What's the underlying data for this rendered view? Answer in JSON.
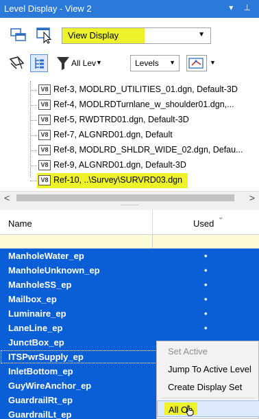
{
  "window": {
    "title": "Level Display - View 2",
    "controls": "▾ ⊥"
  },
  "toolbar": {
    "view_display_value": "View Display",
    "all_levels_label": "All Lev",
    "levels_label": "Levels"
  },
  "tree": {
    "badge": "V8",
    "items": [
      "Ref-3, MODLRD_UTILITIES_01.dgn, Default-3D",
      "Ref-4, MODLRDTurnlane_w_shoulder01.dgn,...",
      "Ref-5, RWDTRD01.dgn, Default-3D",
      "Ref-7, ALGNRD01.dgn, Default",
      "Ref-8, MODLRD_SHLDR_WIDE_02.dgn, Defau...",
      "Ref-9, ALGNRD01.dgn, Default-3D",
      "Ref-10, ..\\Survey\\SURVRD03.dgn"
    ]
  },
  "scroll": {
    "left": "<",
    "right": ">",
    "grip": "··········"
  },
  "columns": {
    "name": "Name",
    "used": "Used",
    "sort_icon": "⌄"
  },
  "levels": [
    {
      "name": "ManholeWater_ep",
      "used": "•"
    },
    {
      "name": "ManholeUnknown_ep",
      "used": "•"
    },
    {
      "name": "ManholeSS_ep",
      "used": "•"
    },
    {
      "name": "Mailbox_ep",
      "used": "•"
    },
    {
      "name": "Luminaire_ep",
      "used": "•"
    },
    {
      "name": "LaneLine_ep",
      "used": "•"
    },
    {
      "name": "JunctBox_ep",
      "used": "•"
    },
    {
      "name": "ITSPwrSupply_ep",
      "used": ""
    },
    {
      "name": "InletBottom_ep",
      "used": ""
    },
    {
      "name": "GuyWireAnchor_ep",
      "used": ""
    },
    {
      "name": "GuardrailRt_ep",
      "used": ""
    },
    {
      "name": "GuardrailLt_ep",
      "used": ""
    }
  ],
  "context_menu": {
    "set_active": "Set Active",
    "jump_to_active": "Jump To Active Level",
    "create_display_set": "Create Display Set",
    "all_on": "All On"
  }
}
